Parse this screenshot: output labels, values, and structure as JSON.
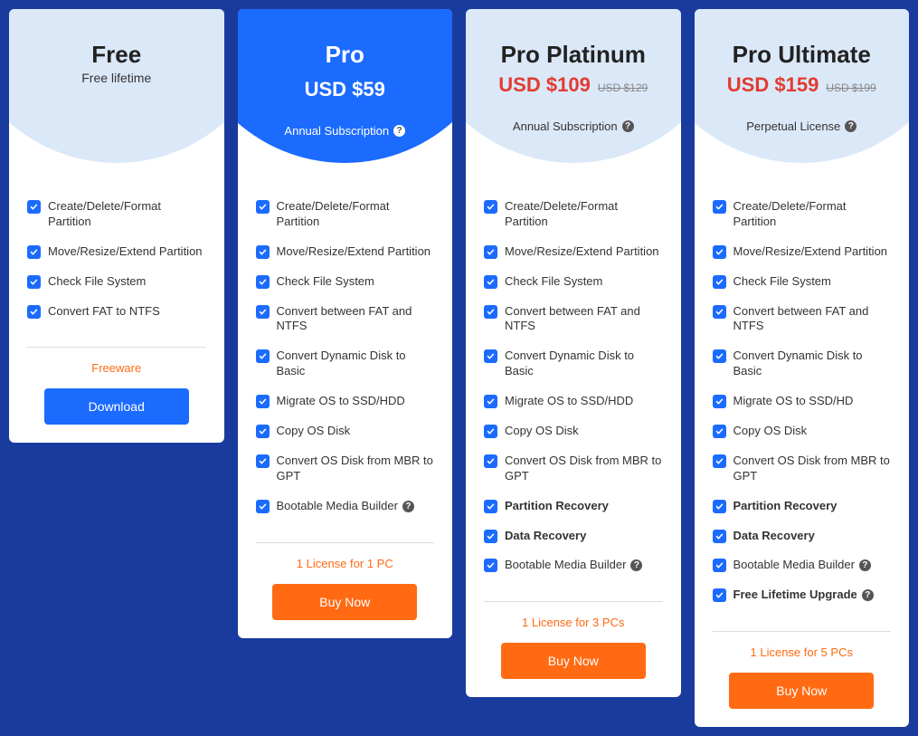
{
  "plans": [
    {
      "name": "Free",
      "sub": "Free lifetime",
      "licenseType": "",
      "features": [
        {
          "text": "Create/Delete/Format Partition",
          "bold": false,
          "info": false
        },
        {
          "text": "Move/Resize/Extend Partition",
          "bold": false,
          "info": false
        },
        {
          "text": "Check File System",
          "bold": false,
          "info": false
        },
        {
          "text": "Convert FAT to NTFS",
          "bold": false,
          "info": false
        }
      ],
      "tag": "Freeware",
      "button": "Download",
      "buttonStyle": "blue",
      "headerStyle": "light",
      "priceStyle": "none"
    },
    {
      "name": "Pro",
      "price": "USD $59",
      "licenseType": "Annual Subscription",
      "features": [
        {
          "text": "Create/Delete/Format Partition",
          "bold": false,
          "info": false
        },
        {
          "text": "Move/Resize/Extend Partition",
          "bold": false,
          "info": false
        },
        {
          "text": "Check File System",
          "bold": false,
          "info": false
        },
        {
          "text": "Convert between FAT and NTFS",
          "bold": false,
          "info": false
        },
        {
          "text": "Convert Dynamic Disk to Basic",
          "bold": false,
          "info": false
        },
        {
          "text": "Migrate OS to SSD/HDD",
          "bold": false,
          "info": false
        },
        {
          "text": "Copy OS Disk",
          "bold": false,
          "info": false
        },
        {
          "text": "Convert OS Disk from MBR to GPT",
          "bold": false,
          "info": false
        },
        {
          "text": "Bootable Media Builder",
          "bold": false,
          "info": true
        }
      ],
      "tag": "1 License for 1 PC",
      "button": "Buy Now",
      "buttonStyle": "orange",
      "headerStyle": "blue",
      "priceStyle": "white"
    },
    {
      "name": "Pro Platinum",
      "price": "USD $109",
      "oldPrice": "USD $129",
      "licenseType": "Annual Subscription",
      "features": [
        {
          "text": "Create/Delete/Format Partition",
          "bold": false,
          "info": false
        },
        {
          "text": "Move/Resize/Extend Partition",
          "bold": false,
          "info": false
        },
        {
          "text": "Check File System",
          "bold": false,
          "info": false
        },
        {
          "text": "Convert between FAT and NTFS",
          "bold": false,
          "info": false
        },
        {
          "text": "Convert Dynamic Disk to Basic",
          "bold": false,
          "info": false
        },
        {
          "text": "Migrate OS to SSD/HDD",
          "bold": false,
          "info": false
        },
        {
          "text": "Copy OS Disk",
          "bold": false,
          "info": false
        },
        {
          "text": "Convert OS Disk from MBR to GPT",
          "bold": false,
          "info": false
        },
        {
          "text": "Partition Recovery",
          "bold": true,
          "info": false
        },
        {
          "text": "Data Recovery",
          "bold": true,
          "info": false
        },
        {
          "text": "Bootable Media Builder",
          "bold": false,
          "info": true
        }
      ],
      "tag": "1 License for 3 PCs",
      "button": "Buy Now",
      "buttonStyle": "orange",
      "headerStyle": "light",
      "priceStyle": "red"
    },
    {
      "name": "Pro Ultimate",
      "price": "USD $159",
      "oldPrice": "USD $199",
      "licenseType": "Perpetual License",
      "features": [
        {
          "text": "Create/Delete/Format Partition",
          "bold": false,
          "info": false
        },
        {
          "text": "Move/Resize/Extend Partition",
          "bold": false,
          "info": false
        },
        {
          "text": "Check File System",
          "bold": false,
          "info": false
        },
        {
          "text": "Convert between FAT and NTFS",
          "bold": false,
          "info": false
        },
        {
          "text": "Convert Dynamic Disk to Basic",
          "bold": false,
          "info": false
        },
        {
          "text": "Migrate OS to SSD/HD",
          "bold": false,
          "info": false
        },
        {
          "text": "Copy OS Disk",
          "bold": false,
          "info": false
        },
        {
          "text": "Convert OS Disk from MBR to GPT",
          "bold": false,
          "info": false
        },
        {
          "text": "Partition Recovery",
          "bold": true,
          "info": false
        },
        {
          "text": "Data Recovery",
          "bold": true,
          "info": false
        },
        {
          "text": "Bootable Media Builder",
          "bold": false,
          "info": true
        },
        {
          "text": "Free Lifetime Upgrade",
          "bold": true,
          "info": true
        }
      ],
      "tag": "1 License for 5 PCs",
      "button": "Buy Now",
      "buttonStyle": "orange",
      "headerStyle": "light",
      "priceStyle": "red"
    }
  ]
}
